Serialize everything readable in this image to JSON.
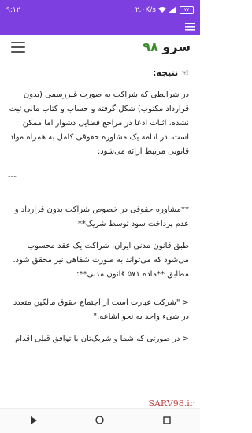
{
  "status": {
    "time": "۹:۱۲",
    "network_info": "۲.۰K/s",
    "battery": "۷۷"
  },
  "header": {
    "logo_number": "۹۸",
    "logo_word": "سرو"
  },
  "icons": {
    "menu": "hamburger-menu-icon",
    "hand": "pointing-hand-icon",
    "back": "back-triangle-icon",
    "home": "home-circle-icon",
    "recents": "recents-square-icon"
  },
  "colors": {
    "status_bar": "#7d3fe0",
    "logo_number": "#3b8a2c"
  },
  "article": {
    "result_heading": "نتیجه:",
    "para1": "در شرایطی که شراکت به صورت غیررسمی (بدون قرارداد مکتوب) شکل گرفته و حساب و کتاب مالی ثبت نشده، اثبات ادعا در مراجع قضایی دشوار اما ممکن است. در ادامه یک مشاوره حقوقی کامل به همراه مواد قانونی مرتبط ارائه می‌شود:",
    "rule": "---",
    "para2": "**مشاوره حقوقی در خصوص شراکت بدون قرارداد و عدم پرداخت سود توسط شریک**",
    "para3": "طبق قانون مدنی ایران، شراکت یک عقد محسوب می‌شود که می‌تواند به صورت شفاهی نیز محقق شود. مطابق **ماده ۵۷۱ قانون مدنی**:",
    "quote": "< \"شرکت عبارت است از اجتماع حقوق مالکین متعدد در شیء واحد به نحو اشاعه.\"",
    "para4": "< در صورتی که شما و شریک‌تان با توافق قبلی اقدام"
  },
  "watermark": "SARV98.ir"
}
